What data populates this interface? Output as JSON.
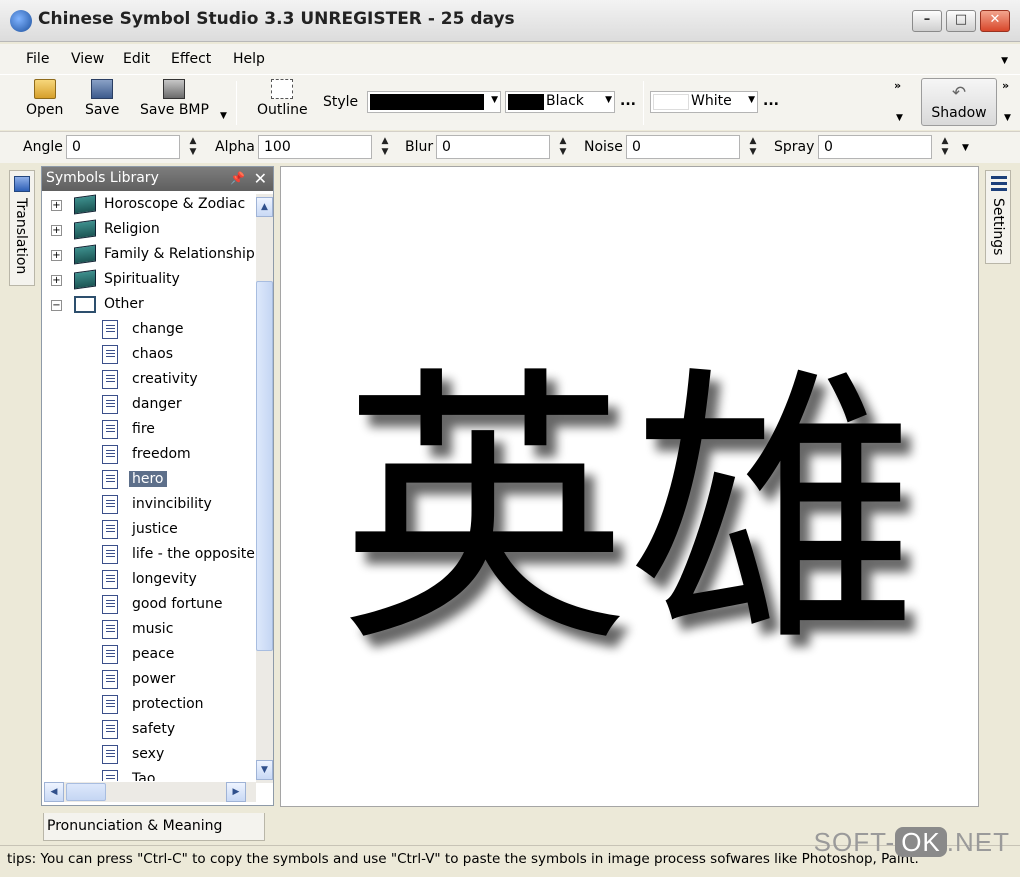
{
  "window": {
    "title": "Chinese Symbol Studio 3.3 UNREGISTER - 25 days"
  },
  "menu": [
    "File",
    "View",
    "Edit",
    "Effect",
    "Help"
  ],
  "toolbar": {
    "open": "Open",
    "save": "Save",
    "save_bmp": "Save BMP",
    "outline": "Outline",
    "style_label": "Style",
    "color_fore": "Black",
    "color_back": "White",
    "dots": "...",
    "shadow": "Shadow"
  },
  "params": {
    "angle_label": "Angle",
    "angle": "0",
    "alpha_label": "Alpha",
    "alpha": "100",
    "blur_label": "Blur",
    "blur": "0",
    "noise_label": "Noise",
    "noise": "0",
    "spray_label": "Spray",
    "spray": "0"
  },
  "left_tab": "Translation",
  "right_tab": "Settings",
  "library": {
    "title": "Symbols Library",
    "categories": [
      "Horoscope & Zodiac",
      "Religion",
      "Family & Relationship",
      "Spirituality",
      "Other"
    ],
    "items": [
      "change",
      "chaos",
      "creativity",
      "danger",
      "fire",
      "freedom",
      "hero",
      "invincibility",
      "justice",
      "life - the opposite",
      "longevity",
      "good fortune",
      "music",
      "peace",
      "power",
      "protection",
      "safety",
      "sexy",
      "Tao"
    ],
    "selected": "hero"
  },
  "canvas": {
    "symbol": "英雄"
  },
  "bottom_tab": "Pronunciation & Meaning",
  "status": "tips: You can press \"Ctrl-C\" to copy the symbols and use \"Ctrl-V\" to paste the symbols in image process sofwares like Photoshop, Paint.",
  "watermark": {
    "a": "SOFT-",
    "b": "OK",
    "c": ".NET"
  }
}
